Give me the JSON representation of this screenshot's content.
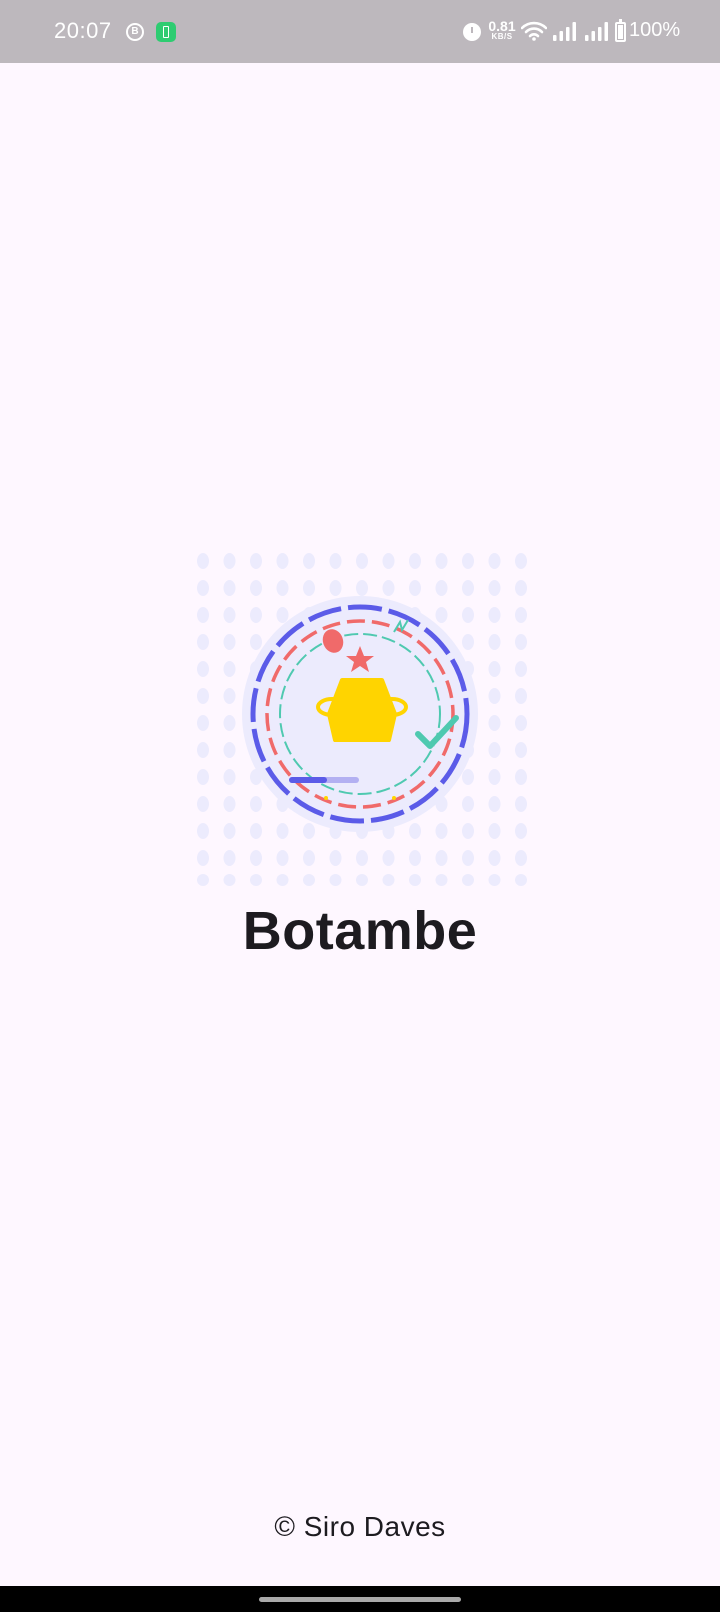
{
  "status_bar": {
    "time": "20:07",
    "notification_icons": [
      "b-circle-icon",
      "battery-saver-icon"
    ],
    "net_speed_value": "0.81",
    "net_speed_unit": "KB/S",
    "battery_percent": "100%",
    "system_icons": [
      "alarm-icon",
      "wifi-icon",
      "signal-icon",
      "signal-icon",
      "battery-icon"
    ]
  },
  "splash": {
    "app_name": "Botambe",
    "logo_icon": "trophy-badge-icon",
    "copyright": "© Siro Daves"
  },
  "colors": {
    "background": "#FEF7FF",
    "status_bar": "#BDB8BD",
    "title_text": "#1D1B20",
    "logo_purple": "#5B5BE8",
    "logo_red": "#F06A6A",
    "logo_teal": "#4FC9B0",
    "logo_yellow": "#FFD400",
    "logo_halo": "#ECEBFD"
  }
}
